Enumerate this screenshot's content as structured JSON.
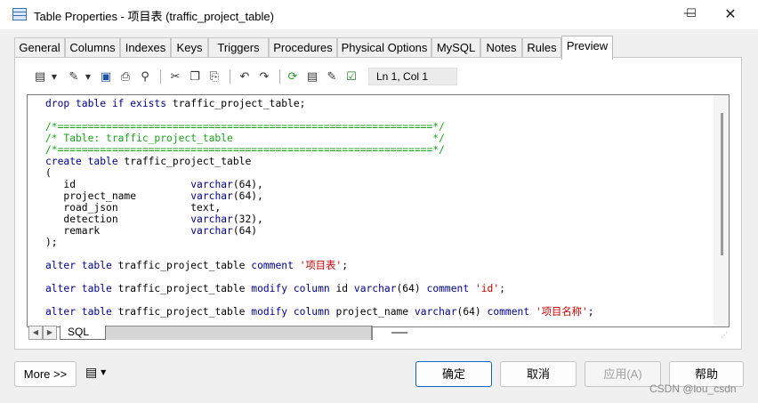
{
  "window": {
    "title": "Table Properties - 项目表 (traffic_project_table)",
    "min_icon": "minimize-icon",
    "max_icon": "maximize-icon",
    "close_icon": "close-icon"
  },
  "tabs": [
    {
      "label": "General"
    },
    {
      "label": "Columns"
    },
    {
      "label": "Indexes"
    },
    {
      "label": "Keys"
    },
    {
      "label": "Triggers"
    },
    {
      "label": "Procedures"
    },
    {
      "label": "Physical Options"
    },
    {
      "label": "MySQL"
    },
    {
      "label": "Notes"
    },
    {
      "label": "Rules"
    },
    {
      "label": "Preview",
      "active": true
    }
  ],
  "toolbar": {
    "icons": [
      "edit-menu-icon",
      "properties-menu-icon",
      "save-icon",
      "print-icon",
      "find-icon",
      "cut-icon",
      "copy-icon",
      "paste-icon",
      "undo-icon",
      "redo-icon",
      "refresh-icon",
      "view-icon",
      "edit-icon",
      "check-icon"
    ],
    "position": "Ln 1, Col 1"
  },
  "code_lines": [
    [
      {
        "c": "kw",
        "t": "drop table if exists "
      },
      {
        "c": "pl",
        "t": "traffic_project_table;"
      }
    ],
    [],
    [
      {
        "c": "cm",
        "t": "/*==============================================================*/"
      }
    ],
    [
      {
        "c": "cm",
        "t": "/* Table: traffic_project_table                                 */"
      }
    ],
    [
      {
        "c": "cm",
        "t": "/*==============================================================*/"
      }
    ],
    [
      {
        "c": "kw",
        "t": "create table "
      },
      {
        "c": "pl",
        "t": "traffic_project_table"
      }
    ],
    [
      {
        "c": "pl",
        "t": "("
      }
    ],
    [
      {
        "c": "pl",
        "t": "   id                   "
      },
      {
        "c": "kw",
        "t": "varchar"
      },
      {
        "c": "pl",
        "t": "(64),"
      }
    ],
    [
      {
        "c": "pl",
        "t": "   project_name         "
      },
      {
        "c": "kw",
        "t": "varchar"
      },
      {
        "c": "pl",
        "t": "(64),"
      }
    ],
    [
      {
        "c": "pl",
        "t": "   road_json            text,"
      }
    ],
    [
      {
        "c": "pl",
        "t": "   detection            "
      },
      {
        "c": "kw",
        "t": "varchar"
      },
      {
        "c": "pl",
        "t": "(32),"
      }
    ],
    [
      {
        "c": "pl",
        "t": "   remark               "
      },
      {
        "c": "kw",
        "t": "varchar"
      },
      {
        "c": "pl",
        "t": "(64)"
      }
    ],
    [
      {
        "c": "pl",
        "t": ");"
      }
    ],
    [],
    [
      {
        "c": "kw",
        "t": "alter table "
      },
      {
        "c": "pl",
        "t": "traffic_project_table "
      },
      {
        "c": "kw",
        "t": "comment "
      },
      {
        "c": "st",
        "t": "'项目表'"
      },
      {
        "c": "pl",
        "t": ";"
      }
    ],
    [],
    [
      {
        "c": "kw",
        "t": "alter table "
      },
      {
        "c": "pl",
        "t": "traffic_project_table "
      },
      {
        "c": "kw",
        "t": "modify column "
      },
      {
        "c": "pl",
        "t": "id "
      },
      {
        "c": "kw",
        "t": "varchar"
      },
      {
        "c": "pl",
        "t": "(64) "
      },
      {
        "c": "kw",
        "t": "comment "
      },
      {
        "c": "st",
        "t": "'id'"
      },
      {
        "c": "pl",
        "t": ";"
      }
    ],
    [],
    [
      {
        "c": "kw",
        "t": "alter table "
      },
      {
        "c": "pl",
        "t": "traffic_project_table "
      },
      {
        "c": "kw",
        "t": "modify column "
      },
      {
        "c": "pl",
        "t": "project_name "
      },
      {
        "c": "kw",
        "t": "varchar"
      },
      {
        "c": "pl",
        "t": "(64) "
      },
      {
        "c": "kw",
        "t": "comment "
      },
      {
        "c": "st",
        "t": "'项目名称'"
      },
      {
        "c": "pl",
        "t": ";"
      }
    ]
  ],
  "editor": {
    "sheet_tab": "SQL",
    "scroll_left_icon": "scroll-left-icon",
    "scroll_right_icon": "scroll-right-icon"
  },
  "buttons": {
    "more": "More >>",
    "ok": "确定",
    "cancel": "取消",
    "apply": "应用(A)",
    "help": "帮助"
  },
  "watermark": "CSDN @lou_csdn"
}
